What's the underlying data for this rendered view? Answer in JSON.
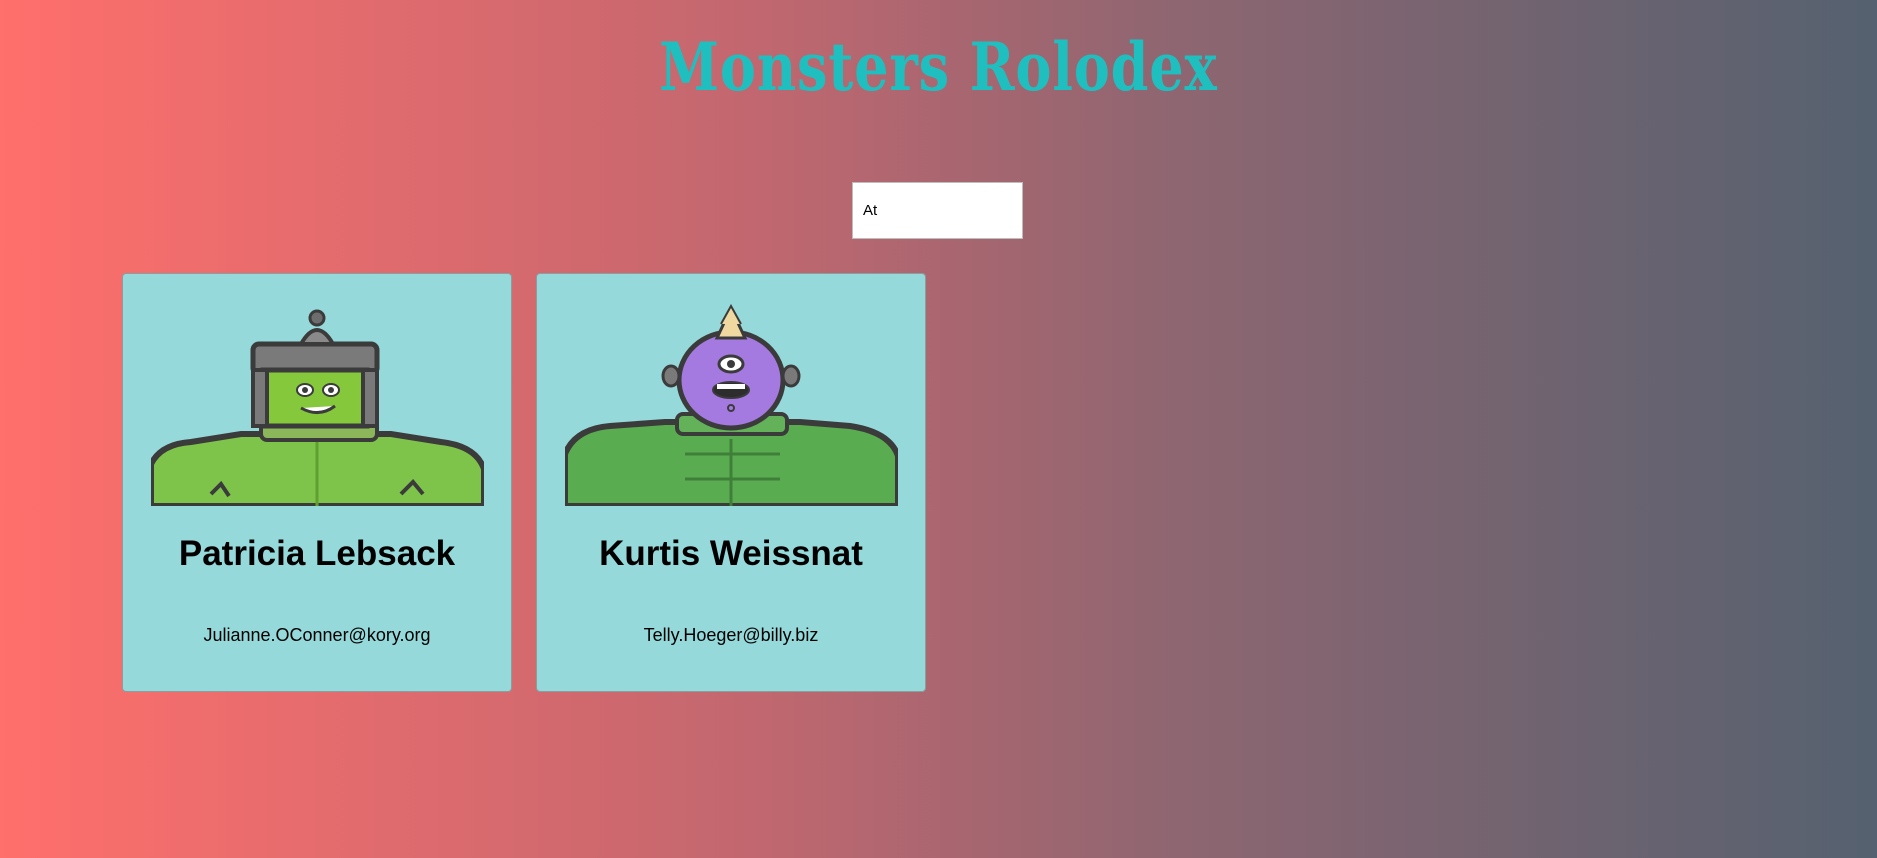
{
  "header": {
    "title": "Monsters Rolodex",
    "title_color": "#1fbfc0"
  },
  "search": {
    "value": "At",
    "placeholder": "search monsters"
  },
  "monsters": [
    {
      "name": "Patricia Lebsack",
      "email": "Julianne.OConner@kory.org",
      "avatar": "helmet-robot-monster-icon"
    },
    {
      "name": "Kurtis Weissnat",
      "email": "Telly.Hoeger@billy.biz",
      "avatar": "horned-purple-monster-icon"
    }
  ],
  "colors": {
    "background_start": "#ff6f6c",
    "background_end": "#556170",
    "card_background": "#95d9da"
  }
}
